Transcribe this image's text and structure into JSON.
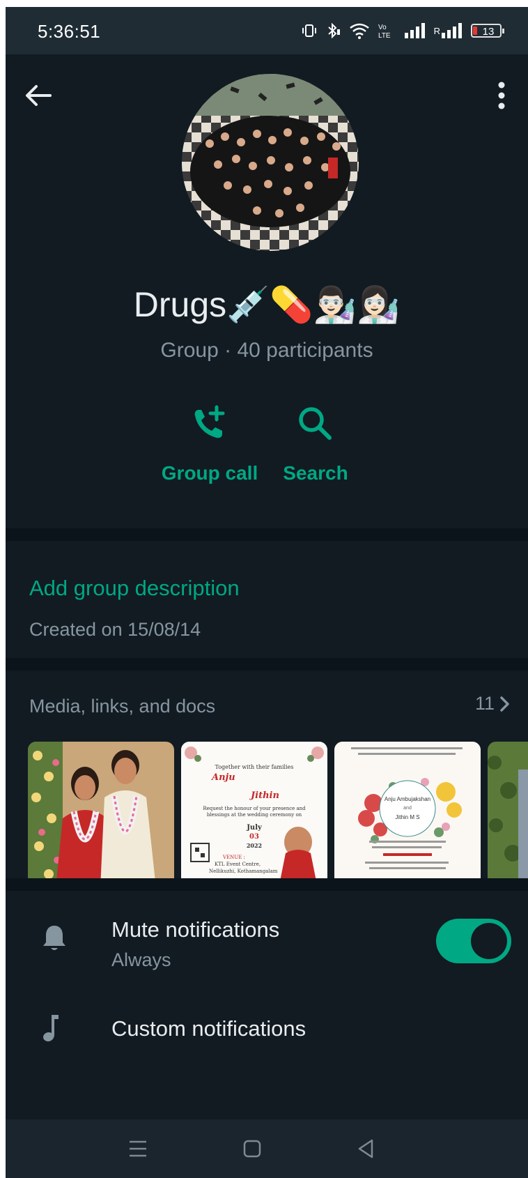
{
  "status_bar": {
    "time": "5:36:51",
    "battery": "13",
    "network_label": "R"
  },
  "header": {
    "group_name": "Drugs💉💊👨🏻‍🔬👩🏻‍🔬",
    "subtitle": "Group · 40 participants",
    "actions": [
      {
        "label": "Group call",
        "icon": "add-call-icon"
      },
      {
        "label": "Search",
        "icon": "search-icon"
      }
    ]
  },
  "description": {
    "add_label": "Add group description",
    "created": "Created on 15/08/14"
  },
  "media": {
    "title": "Media, links, and docs",
    "count": "11",
    "thumb2": {
      "line1": "Together with their families",
      "name1": "Anju",
      "name2": "Jithin",
      "line2": "Request the honour of your presence and blessings at the wedding ceremony on",
      "month": "July",
      "date": "03",
      "year": "2022",
      "venue": "VENUE :",
      "venue_name": "KTL Event Centre,",
      "venue_place": "Nellikuzhi, Kothamangalam"
    },
    "thumb3": {
      "name1": "Anju Ambujakshan",
      "and": "and",
      "name2": "Jithin M S"
    }
  },
  "settings": {
    "mute_title": "Mute notifications",
    "mute_sub": "Always",
    "mute_on": true,
    "custom_title": "Custom notifications"
  },
  "colors": {
    "accent": "#00a884",
    "background": "#121b22",
    "text_primary": "#e9edef",
    "text_secondary": "#8696a0"
  }
}
